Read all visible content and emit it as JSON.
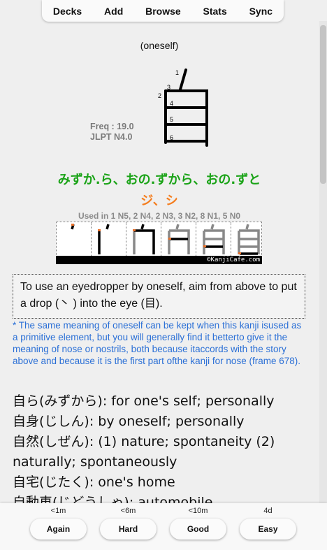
{
  "nav": {
    "decks": "Decks",
    "add": "Add",
    "browse": "Browse",
    "stats": "Stats",
    "sync": "Sync"
  },
  "card": {
    "meaning": "(oneself)",
    "kanji": "自",
    "stroke_numbers": [
      "1",
      "2",
      "3",
      "4",
      "5",
      "6"
    ],
    "freq": "Freq : 19.0",
    "jlpt": "JLPT N4.0",
    "kun_reading": "みずか.ら、おの.ずから、おの.ずと",
    "on_reading": "ジ、シ",
    "usage": "Used in 1 N5, 2 N4, 2 N3, 3 N2, 8 N1, 5 N0",
    "stroke_copyright": "©KanjiCafe.com",
    "story": "To use an eyedropper by oneself, aim from above to put a drop (丶 ) into the eye (目).",
    "note": "* The same meaning of oneself can be kept when this kanji isused as a primitive element, but you will generally find it betterto give it the meaning of nose or nostrils, both because itaccords with the story above and because it is the first part ofthe kanji for nose (frame 678).",
    "vocab": [
      "自ら(みずから): for one's self; personally",
      "自身(じしん): by oneself; personally",
      "自然(しぜん): (1) nature; spontaneity (2) naturally; spontaneously",
      "自宅(じたく): one's home",
      "自動車(じどうしゃ): automobile"
    ]
  },
  "answers": [
    {
      "interval": "<1m",
      "label": "Again"
    },
    {
      "interval": "<6m",
      "label": "Hard"
    },
    {
      "interval": "<10m",
      "label": "Good"
    },
    {
      "interval": "4d",
      "label": "Easy"
    }
  ],
  "colors": {
    "kun": "#1aa317",
    "on": "#f47d1e",
    "note": "#2a6fd6",
    "stroke_start": "#e8702a"
  }
}
